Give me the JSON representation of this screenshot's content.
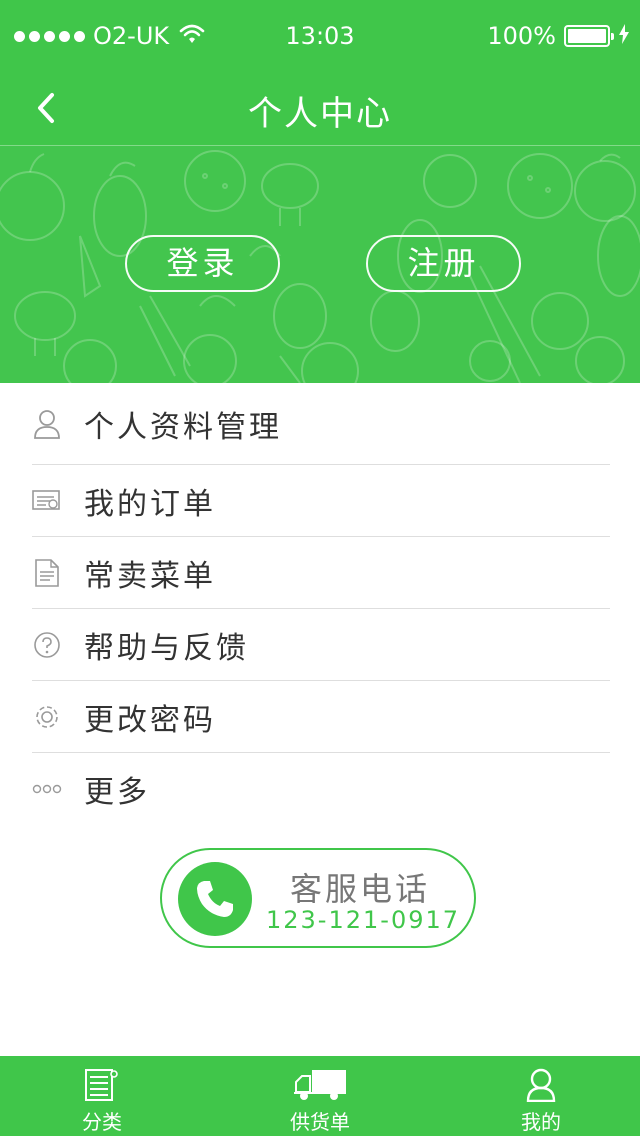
{
  "status_bar": {
    "carrier": "O2-UK",
    "time": "13:03",
    "battery": "100%"
  },
  "nav": {
    "title": "个人中心",
    "back_icon": "chevron-left-icon"
  },
  "hero": {
    "login_label": "登录",
    "register_label": "注册"
  },
  "menu": {
    "items": [
      {
        "label": "个人资料管理",
        "icon": "user-icon"
      },
      {
        "label": "我的订单",
        "icon": "orders-icon"
      },
      {
        "label": "常卖菜单",
        "icon": "document-icon"
      },
      {
        "label": "帮助与反馈",
        "icon": "help-icon"
      },
      {
        "label": "更改密码",
        "icon": "gear-icon"
      },
      {
        "label": "更多",
        "icon": "more-icon"
      }
    ]
  },
  "service": {
    "title": "客服电话",
    "number": "123-121-0917"
  },
  "tabbar": {
    "tabs": [
      {
        "label": "分类",
        "icon": "list-icon"
      },
      {
        "label": "供货单",
        "icon": "truck-icon"
      },
      {
        "label": "我的",
        "icon": "profile-icon"
      }
    ]
  },
  "colors": {
    "brand_green": "#40c64a",
    "text": "#333333",
    "divider": "#dedede"
  }
}
